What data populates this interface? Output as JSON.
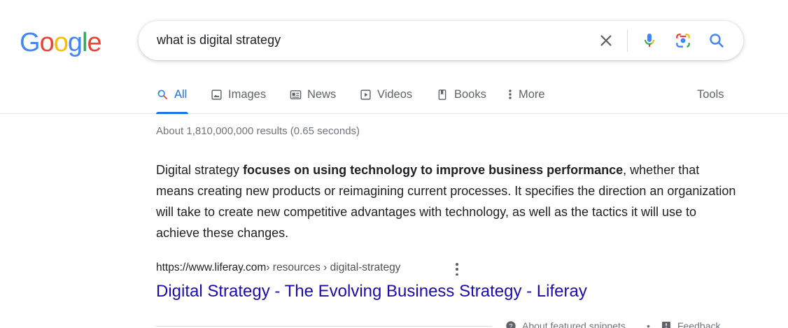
{
  "logo": {
    "letters": [
      "G",
      "o",
      "o",
      "g",
      "l",
      "e"
    ],
    "colors": [
      "#4285F4",
      "#EA4335",
      "#FBBC05",
      "#4285F4",
      "#34A853",
      "#EA4335"
    ]
  },
  "search": {
    "query": "what is digital strategy"
  },
  "icons": {
    "clear": "close-icon",
    "voice": "microphone-icon",
    "lens": "camera-icon",
    "search": "search-icon"
  },
  "tabs": [
    {
      "label": "All",
      "icon": "search-icon",
      "active": true
    },
    {
      "label": "Images",
      "icon": "image-icon"
    },
    {
      "label": "News",
      "icon": "newspaper-icon"
    },
    {
      "label": "Videos",
      "icon": "play-icon"
    },
    {
      "label": "Books",
      "icon": "book-icon"
    },
    {
      "label": "More",
      "icon": "more-vert-icon"
    }
  ],
  "tools_label": "Tools",
  "stats": "About 1,810,000,000 results (0.65 seconds)",
  "snippet": {
    "prefix": "Digital strategy ",
    "bold": "focuses on using technology to improve business performance",
    "rest": ", whether that means creating new products or reimagining current processes. It specifies the direction an organization will take to create new competitive advantages with technology, as well as the tactics it will use to achieve these changes."
  },
  "result": {
    "domain": "https://www.liferay.com",
    "path": " › resources › digital-strategy",
    "title": "Digital Strategy - The Evolving Business Strategy - Liferay"
  },
  "footer": {
    "about_label": "About featured snippets",
    "separator": "•",
    "feedback_label": "Feedback"
  },
  "colors": {
    "accent": "#1a73e8",
    "link": "#1a0dab"
  }
}
